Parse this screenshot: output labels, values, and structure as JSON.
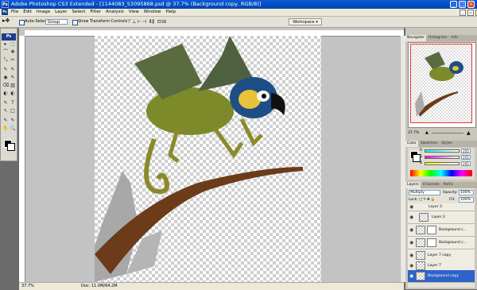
{
  "window": {
    "title": "Adobe Photoshop CS3 Extended - [1144083_53095868.psd @ 37.7% (Background copy, RGB/8)]",
    "ps_badge": "Ps"
  },
  "menu": [
    "File",
    "Edit",
    "Image",
    "Layer",
    "Select",
    "Filter",
    "Analysis",
    "View",
    "Window",
    "Help"
  ],
  "options": {
    "auto_select_label": "Auto-Select:",
    "auto_select_value": "Group",
    "transform_label": "Show Transform Controls",
    "workspace_label": "Workspace ▾"
  },
  "toolbox": {
    "badge": "Ps",
    "tools": [
      "▸",
      "✥",
      "⬚",
      "⌒",
      "✂",
      "⤡",
      "✎",
      "⌫",
      "▥",
      "◐",
      "◉",
      "T",
      "↖",
      "□",
      "✋",
      "🔍"
    ]
  },
  "statusbar": {
    "zoom": "37.7%",
    "doc": "Doc: 11.0M/64.2M"
  },
  "navigator": {
    "tabs": [
      "Navigator",
      "Histogram",
      "Info"
    ],
    "zoom": "37.7%"
  },
  "color_panel": {
    "tabs": [
      "Color",
      "Swatches",
      "Styles"
    ],
    "channels": [
      {
        "label": "R",
        "value": "255"
      },
      {
        "label": "G",
        "value": "255"
      },
      {
        "label": "B",
        "value": "255"
      }
    ]
  },
  "layers_panel": {
    "tabs": [
      "Layers",
      "Channels",
      "Paths"
    ],
    "blend_mode": "Multiply",
    "opacity_label": "Opacity:",
    "opacity": "100%",
    "lock_label": "Lock:",
    "fill_label": "Fill:",
    "fill": "100%",
    "layers": [
      {
        "name": "Layer 3",
        "selected": false
      },
      {
        "name": "Layer 2",
        "selected": false
      },
      {
        "name": "Background c...",
        "selected": false
      },
      {
        "name": "Background c...",
        "selected": false
      },
      {
        "name": "Layer 7 copy",
        "selected": false
      },
      {
        "name": "Layer 7",
        "selected": false
      },
      {
        "name": "Background copy",
        "selected": true
      }
    ]
  },
  "colors": {
    "title_bar": "#0a5ad8",
    "selected_layer": "#2d63c8",
    "nav_frame": "#ee3333"
  }
}
